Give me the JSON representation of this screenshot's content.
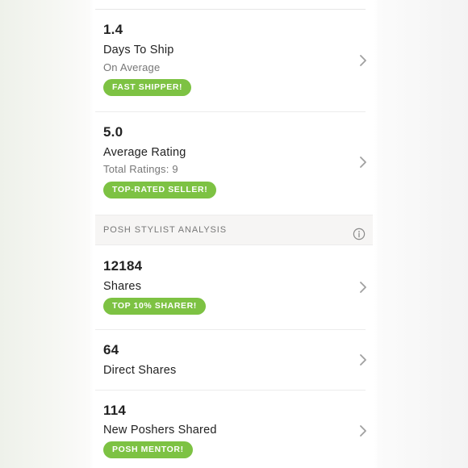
{
  "stats": [
    {
      "value": "1.4",
      "label": "Days To Ship",
      "sublabel": "On Average",
      "badge": "FAST SHIPPER!"
    },
    {
      "value": "5.0",
      "label": "Average Rating",
      "sublabel": "Total Ratings: 9",
      "badge": "TOP-RATED SELLER!"
    }
  ],
  "section": {
    "title": "POSH STYLIST ANALYSIS",
    "info_icon": "info-icon"
  },
  "analysis": [
    {
      "value": "12184",
      "label": "Shares",
      "badge": "TOP 10% SHARER!"
    },
    {
      "value": "64",
      "label": "Direct Shares"
    },
    {
      "value": "114",
      "label": "New Poshers Shared",
      "badge": "POSH MENTOR!"
    }
  ],
  "colors": {
    "badge": "#7dc243",
    "text": "#222222",
    "muted": "#777777",
    "section_bg": "#f6f5f4"
  },
  "icons": {
    "chevron": "chevron-right-icon",
    "info": "info-icon"
  }
}
